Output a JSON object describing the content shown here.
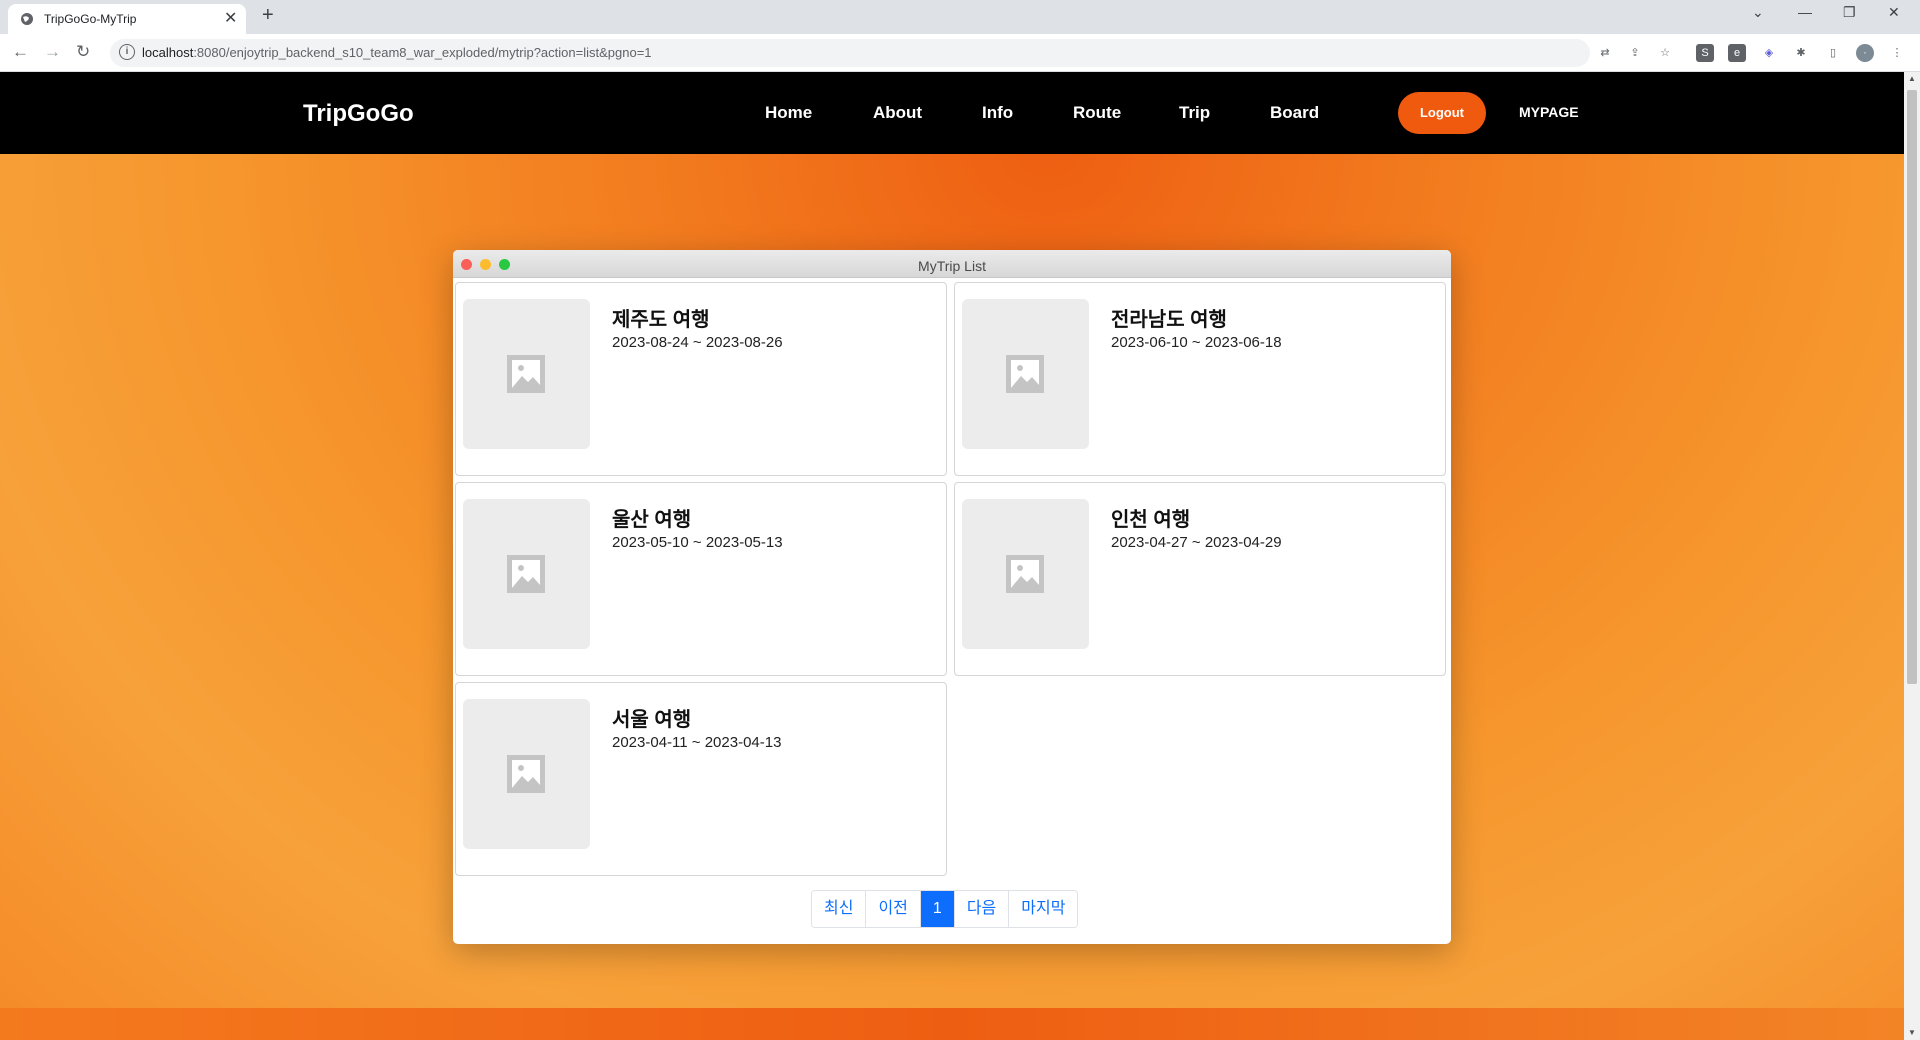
{
  "browser": {
    "tab_title": "TripGoGo-MyTrip",
    "url_host": "localhost",
    "url_rest": ":8080/enjoytrip_backend_s10_team8_war_exploded/mytrip?action=list&pgno=1"
  },
  "site": {
    "logo": "TripGoGo",
    "nav": [
      "Home",
      "About",
      "Info",
      "Route",
      "Trip",
      "Board"
    ],
    "logout": "Logout",
    "mypage": "MYPAGE"
  },
  "window": {
    "title": "MyTrip List"
  },
  "trips": [
    {
      "title": "제주도 여행",
      "dates": "2023-08-24 ~ 2023-08-26"
    },
    {
      "title": "전라남도 여행",
      "dates": "2023-06-10 ~ 2023-06-18"
    },
    {
      "title": "울산 여행",
      "dates": "2023-05-10 ~ 2023-05-13"
    },
    {
      "title": "인천 여행",
      "dates": "2023-04-27 ~ 2023-04-29"
    },
    {
      "title": "서울 여행",
      "dates": "2023-04-11 ~ 2023-04-13"
    }
  ],
  "pagination": {
    "first": "최신",
    "prev": "이전",
    "current": "1",
    "next": "다음",
    "last": "마지막"
  },
  "colors": {
    "accent": "#f05a0f",
    "page_active": "#0d6efd"
  }
}
